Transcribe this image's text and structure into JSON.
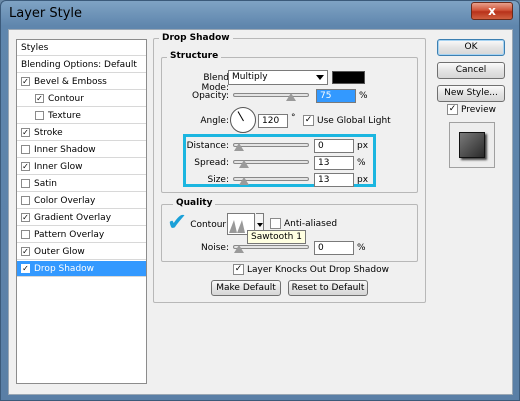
{
  "window": {
    "title": "Layer Style",
    "close_label": "x"
  },
  "sidebar": {
    "header": "Styles",
    "blending": "Blending Options: Default",
    "items": [
      {
        "label": "Bevel & Emboss",
        "checked": true
      },
      {
        "label": "Contour",
        "checked": true
      },
      {
        "label": "Texture",
        "checked": false
      },
      {
        "label": "Stroke",
        "checked": true
      },
      {
        "label": "Inner Shadow",
        "checked": false
      },
      {
        "label": "Inner Glow",
        "checked": true
      },
      {
        "label": "Satin",
        "checked": false
      },
      {
        "label": "Color Overlay",
        "checked": false
      },
      {
        "label": "Gradient Overlay",
        "checked": true
      },
      {
        "label": "Pattern Overlay",
        "checked": false
      },
      {
        "label": "Outer Glow",
        "checked": true
      },
      {
        "label": "Drop Shadow",
        "checked": true,
        "selected": true
      }
    ]
  },
  "drop_shadow": {
    "title": "Drop Shadow",
    "structure": {
      "title": "Structure",
      "blend_mode_label": "Blend Mode:",
      "blend_mode_value": "Multiply",
      "blend_color": "#000000",
      "opacity_label": "Opacity:",
      "opacity_value": "75",
      "opacity_unit": "%",
      "angle_label": "Angle:",
      "angle_value": "120",
      "angle_unit": "°",
      "use_global_light_label": "Use Global Light",
      "use_global_light_checked": true,
      "distance_label": "Distance:",
      "distance_value": "0",
      "distance_unit": "px",
      "spread_label": "Spread:",
      "spread_value": "13",
      "spread_unit": "%",
      "size_label": "Size:",
      "size_value": "13",
      "size_unit": "px"
    },
    "quality": {
      "title": "Quality",
      "contour_label": "Contour:",
      "anti_aliased_label": "Anti-aliased",
      "anti_aliased_checked": false,
      "contour_tooltip": "Sawtooth 1",
      "noise_label": "Noise:",
      "noise_value": "0",
      "noise_unit": "%"
    },
    "knockout_label": "Layer Knocks Out Drop Shadow",
    "knockout_checked": true,
    "make_default_label": "Make Default",
    "reset_default_label": "Reset to Default"
  },
  "actions": {
    "ok_label": "OK",
    "cancel_label": "Cancel",
    "new_style_label": "New Style...",
    "preview_label": "Preview",
    "preview_checked": true
  },
  "highlight_color": "#1bb6e0"
}
